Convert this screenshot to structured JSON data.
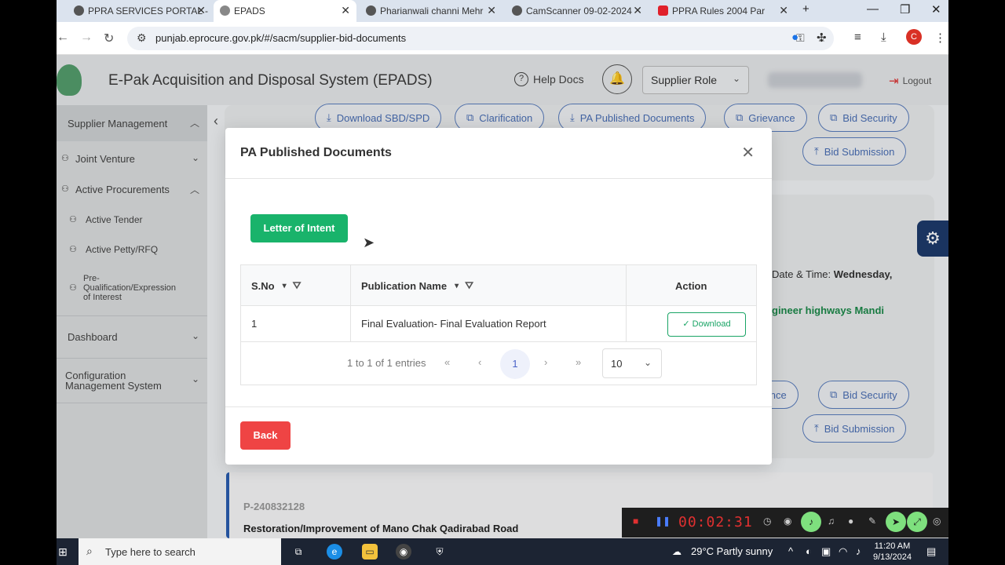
{
  "browser": {
    "tabs": [
      {
        "title": "PPRA SERVICES PORTAL -"
      },
      {
        "title": "EPADS"
      },
      {
        "title": "Pharianwali channi Mehr"
      },
      {
        "title": "CamScanner 09-02-2024"
      },
      {
        "title": "PPRA Rules 2004 Par"
      }
    ],
    "new_tab": "+",
    "url": "punjab.eprocure.gov.pk/#/sacm/supplier-bid-documents",
    "profile_initial": "C"
  },
  "app": {
    "title": "E-Pak Acquisition and Disposal System (EPADS)",
    "help_docs": "Help Docs",
    "role": "Supplier Role",
    "logout": "Logout"
  },
  "sidebar": {
    "items": [
      {
        "label": "Supplier Management"
      },
      {
        "label": "Joint Venture"
      },
      {
        "label": "Active Procurements"
      },
      {
        "label": "Active Tender"
      },
      {
        "label": "Active Petty/RFQ"
      },
      {
        "label": "Pre-"
      },
      {
        "label": "Qualification/Expression"
      },
      {
        "label": "of Interest"
      },
      {
        "label": "Dashboard"
      },
      {
        "label": "Configuration"
      },
      {
        "label": "Management System"
      }
    ]
  },
  "background": {
    "actions": [
      "Download SBD/SPD",
      "Clarification",
      "PA Published Documents",
      "Grievance",
      "Bid Security",
      "Bid Submission"
    ],
    "actions2": [
      "vance",
      "Bid Security",
      "Bid Submission"
    ],
    "date_label": "Date & Time: ",
    "date_value": "Wednesday,",
    "green_text": "gineer highways Mandi",
    "proc_id": "P-240832128",
    "proc_title": "Restoration/Improvement of Mano Chak Qadirabad Road"
  },
  "modal": {
    "title": "PA Published Documents",
    "letter_of_intent": "Letter of Intent",
    "columns": [
      "S.No",
      "Publication Name",
      "Action"
    ],
    "rows": [
      {
        "sno": "1",
        "name": "Final Evaluation- Final Evaluation Report",
        "action": "Download"
      }
    ],
    "pager": {
      "summary": "1 to 1 of 1 entries",
      "current_page": "1",
      "page_size": "10"
    },
    "back": "Back"
  },
  "recorder": {
    "time": "00:02:31"
  },
  "taskbar": {
    "search_placeholder": "Type here to search",
    "weather": "29°C  Partly sunny",
    "time": "11:20 AM",
    "date": "9/13/2024"
  },
  "colors": {
    "primary_green": "#19b36b",
    "danger_red": "#ef4444",
    "link_blue": "#4a6fb5"
  }
}
